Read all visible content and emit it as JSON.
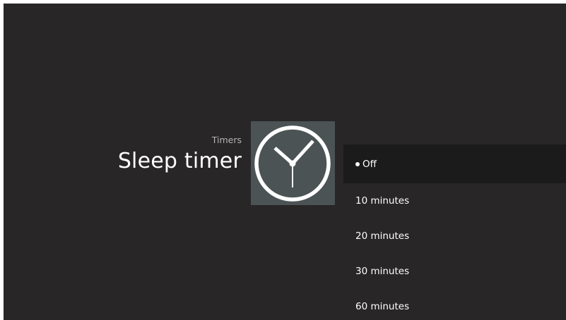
{
  "header": {
    "category": "Timers",
    "title": "Sleep timer"
  },
  "tile": {
    "icon": "clock-icon",
    "background": "#4b5354"
  },
  "options": [
    {
      "label": "Off",
      "selected": true
    },
    {
      "label": "10 minutes",
      "selected": false
    },
    {
      "label": "20 minutes",
      "selected": false
    },
    {
      "label": "30 minutes",
      "selected": false
    },
    {
      "label": "60 minutes",
      "selected": false
    }
  ],
  "colors": {
    "background": "#282627",
    "selected_row": "#1c1b1c",
    "text": "#ffffff",
    "secondary_text": "#b5b5b5"
  }
}
